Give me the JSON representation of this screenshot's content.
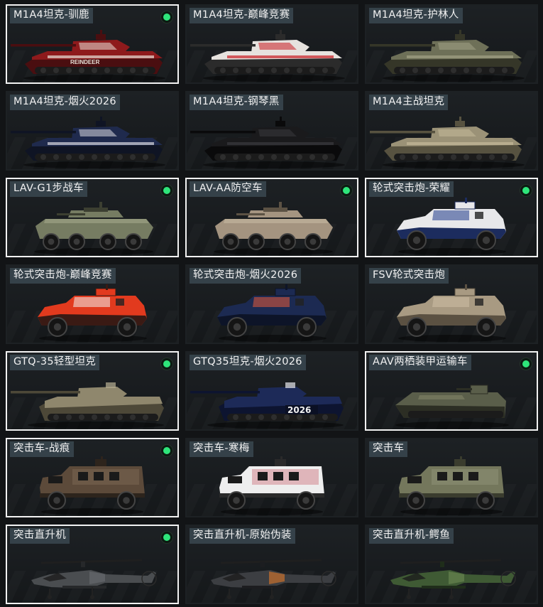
{
  "vehicles": [
    {
      "label": "M1A4坦克-驯鹿",
      "type": "tank",
      "selected": true,
      "badge": true,
      "colors": {
        "body": "#8e1a1c",
        "dark": "#4a0e10",
        "accent": "#e8e2d8"
      },
      "decal": "REINDEER"
    },
    {
      "label": "M1A4坦克-巅峰竞赛",
      "type": "tank",
      "selected": false,
      "badge": false,
      "colors": {
        "body": "#e6e2de",
        "dark": "#2b2b2b",
        "accent": "#c81e24"
      }
    },
    {
      "label": "M1A4坦克-护林人",
      "type": "tank",
      "selected": false,
      "badge": false,
      "colors": {
        "body": "#6e7058",
        "dark": "#353628",
        "accent": "#a3a386"
      }
    },
    {
      "label": "M1A4坦克-烟火2026",
      "type": "tank",
      "selected": false,
      "badge": false,
      "colors": {
        "body": "#1f2a4d",
        "dark": "#0f1424",
        "accent": "#d8d8e0"
      }
    },
    {
      "label": "M1A4坦克-钢琴黑",
      "type": "tank",
      "selected": false,
      "badge": false,
      "colors": {
        "body": "#1a1a1c",
        "dark": "#0a0a0b",
        "accent": "#3a3a3e"
      }
    },
    {
      "label": "M1A4主战坦克",
      "type": "tank",
      "selected": false,
      "badge": false,
      "colors": {
        "body": "#9b9277",
        "dark": "#575240",
        "accent": "#c4b99a"
      }
    },
    {
      "label": "LAV-G1步战车",
      "type": "apc",
      "selected": true,
      "badge": true,
      "colors": {
        "body": "#767c62",
        "dark": "#3c3f31",
        "accent": "#a4a98b"
      }
    },
    {
      "label": "LAV-AA防空车",
      "type": "apc",
      "selected": true,
      "badge": true,
      "colors": {
        "body": "#a49480",
        "dark": "#5c5244",
        "accent": "#c7b9a2"
      }
    },
    {
      "label": "轮式突击炮-荣耀",
      "type": "wheeled",
      "selected": true,
      "badge": true,
      "colors": {
        "body": "#e8e8ea",
        "dark": "#1c2c5e",
        "accent": "#1f3a8a"
      }
    },
    {
      "label": "轮式突击炮-巅峰竞赛",
      "type": "wheeled",
      "selected": false,
      "badge": false,
      "colors": {
        "body": "#e23a1e",
        "dark": "#3a1a14",
        "accent": "#f1efec"
      }
    },
    {
      "label": "轮式突击炮-烟火2026",
      "type": "wheeled",
      "selected": false,
      "badge": false,
      "colors": {
        "body": "#1c2a52",
        "dark": "#0d1428",
        "accent": "#e65a3a"
      }
    },
    {
      "label": "FSV轮式突击炮",
      "type": "wheeled",
      "selected": false,
      "badge": false,
      "colors": {
        "body": "#a89a82",
        "dark": "#5b5142",
        "accent": "#cdbfa5"
      }
    },
    {
      "label": "GTQ-35轻型坦克",
      "type": "light",
      "selected": true,
      "badge": true,
      "colors": {
        "body": "#8f876d",
        "dark": "#4d4838",
        "accent": "#b9b094"
      }
    },
    {
      "label": "GTQ35坦克-烟火2026",
      "type": "light",
      "selected": false,
      "badge": false,
      "colors": {
        "body": "#1d2a58",
        "dark": "#0d1430",
        "accent": "#e8e8ee"
      },
      "decal": "2026"
    },
    {
      "label": "AAV两栖装甲运输车",
      "type": "amph",
      "selected": true,
      "badge": true,
      "colors": {
        "body": "#5a5e4a",
        "dark": "#2c2e24",
        "accent": "#808468"
      }
    },
    {
      "label": "突击车-战痕",
      "type": "truck",
      "selected": true,
      "badge": true,
      "colors": {
        "body": "#5c4a3a",
        "dark": "#2d241c",
        "accent": "#8a7560"
      }
    },
    {
      "label": "突击车-寒梅",
      "type": "truck",
      "selected": false,
      "badge": false,
      "colors": {
        "body": "#eeeeee",
        "dark": "#2a2a2a",
        "accent": "#c24a5a"
      }
    },
    {
      "label": "突击车",
      "type": "truck",
      "selected": false,
      "badge": false,
      "colors": {
        "body": "#74775c",
        "dark": "#3a3c2e",
        "accent": "#9ea083"
      }
    },
    {
      "label": "突击直升机",
      "type": "heli",
      "selected": true,
      "badge": true,
      "colors": {
        "body": "#4a4d50",
        "dark": "#26282a",
        "accent": "#6a6e72"
      }
    },
    {
      "label": "突击直升机-原始伪装",
      "type": "heli",
      "selected": false,
      "badge": false,
      "colors": {
        "body": "#3c3e42",
        "dark": "#1c1d20",
        "accent": "#e07a2a"
      }
    },
    {
      "label": "突击直升机-鳄鱼",
      "type": "heli",
      "selected": false,
      "badge": false,
      "colors": {
        "body": "#3f5a34",
        "dark": "#1f2d1a",
        "accent": "#6e8a55"
      }
    }
  ]
}
